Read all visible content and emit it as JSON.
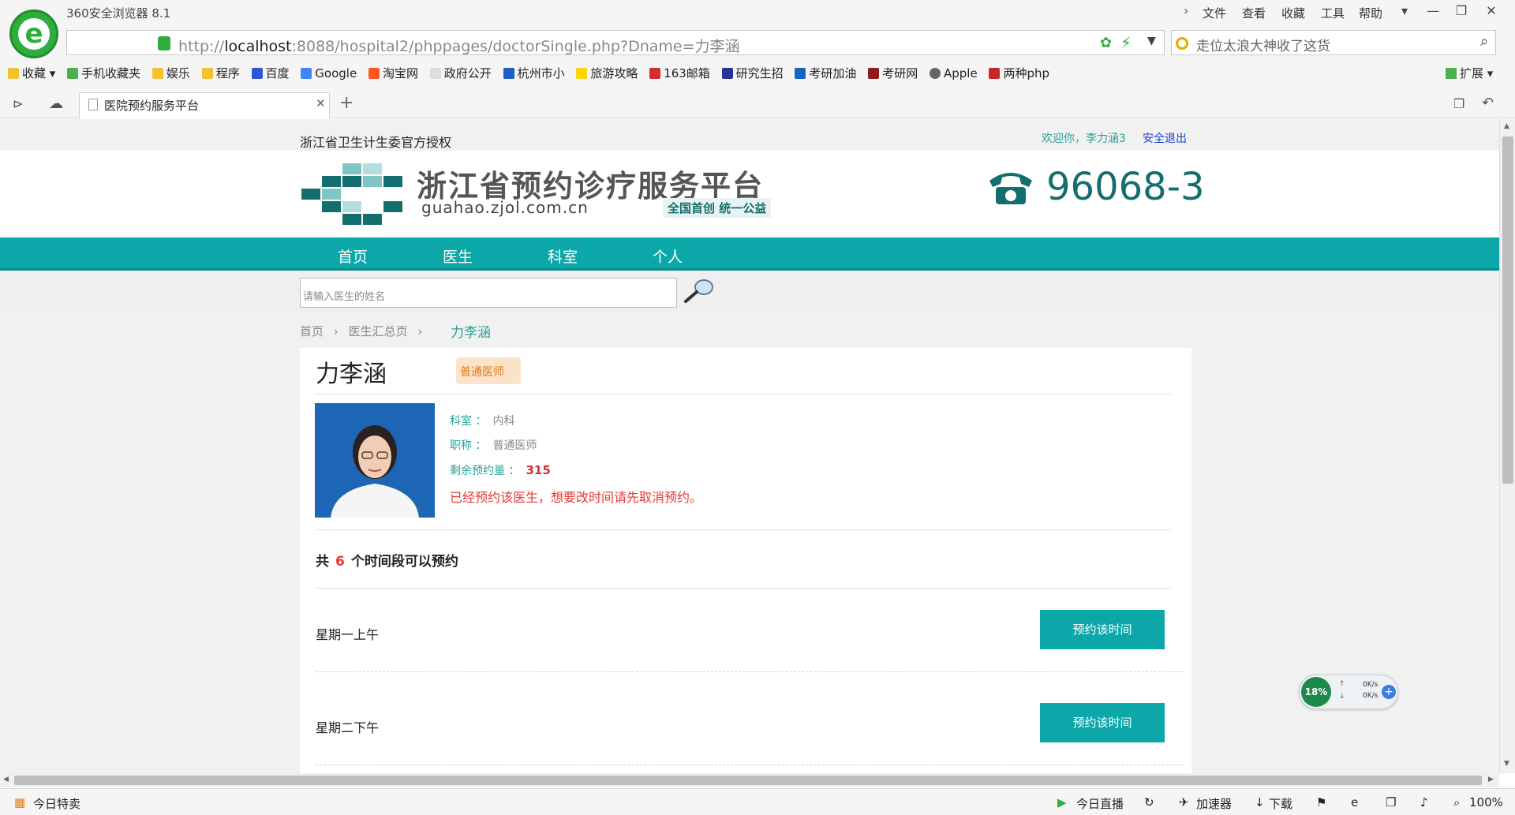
{
  "browser": {
    "title": "360安全浏览器 8.1",
    "menu": [
      "文件",
      "查看",
      "收藏",
      "工具",
      "帮助"
    ],
    "url_prefix": "http://",
    "url_host": "localhost",
    "url_rest": ":8088/hospital2/phppages/doctorSingle.php?Dname=力李涵",
    "search_placeholder": "走位太浪大神收了这货",
    "bookmarks": [
      "收藏",
      "手机收藏夹",
      "娱乐",
      "程序",
      "百度",
      "Google",
      "淘宝网",
      "政府公开",
      "杭州市小",
      "旅游攻略",
      "163邮箱",
      "研究生招",
      "考研加油",
      "考研网",
      "Apple",
      "两种php"
    ],
    "extend_label": "扩展",
    "tab_title": "医院预约服务平台",
    "status_left": "今日特卖",
    "status_right": [
      "今日直播",
      "加速器",
      "下载",
      "100%"
    ]
  },
  "site": {
    "auth_text": "浙江省卫生计生委官方授权",
    "welcome": "欢迎你，李力涵3",
    "logout": "安全退出",
    "name_cn": "浙江省预约诊疗服务平台",
    "url": "guahao.zjol.com.cn",
    "slogan": "全国首创  统一公益",
    "phone": "96068-3",
    "nav": [
      "首页",
      "医生",
      "科室",
      "个人"
    ],
    "search_placeholder": "请输入医生的姓名"
  },
  "breadcrumb": {
    "home": "首页",
    "list": "医生汇总页",
    "current": "力李涵"
  },
  "doctor": {
    "name": "力李涵",
    "badge": "普通医师",
    "dept_label": "科室 ：",
    "dept_value": "内科",
    "title_label": "职称 ：",
    "title_value": "普通医师",
    "remain_label": "剩余预约量 ：",
    "remain_value": "315",
    "notice": "已经预约该医生，想要改时间请先取消预约。"
  },
  "schedule": {
    "total_prefix": "共",
    "total_count": "6",
    "total_suffix": "个时间段可以预约",
    "slots": [
      {
        "label": "星期一上午",
        "button": "预约该时间"
      },
      {
        "label": "星期二下午",
        "button": "预约该时间"
      }
    ]
  },
  "widget": {
    "percent": "18%",
    "up": "0K/s",
    "down": "0K/s"
  },
  "colors": {
    "accent": "#0ba7a9",
    "brand_dark": "#156e6e",
    "alert": "#e53935"
  }
}
